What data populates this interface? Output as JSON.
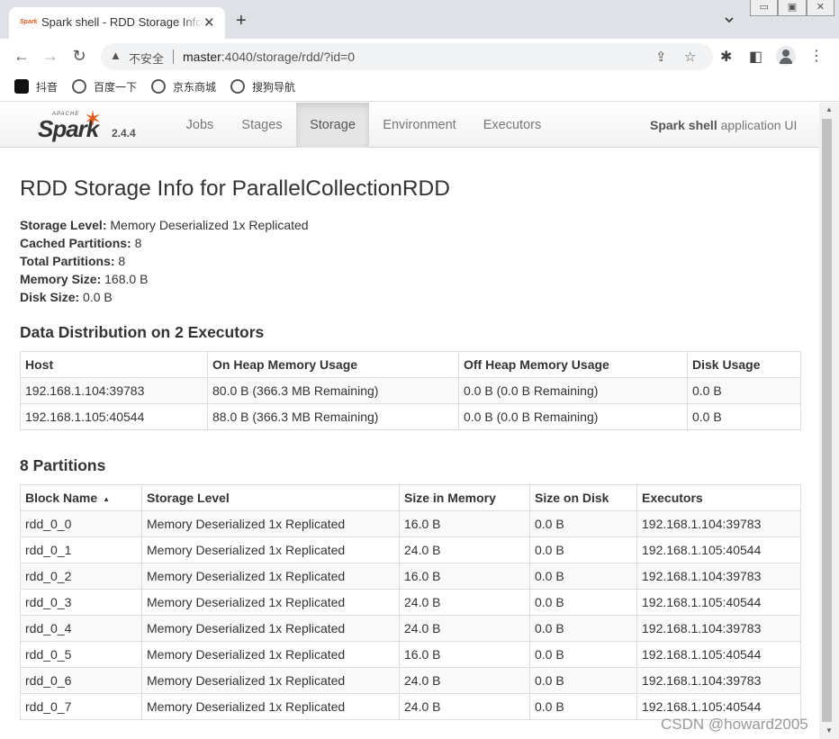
{
  "browser": {
    "tab_title": "Spark shell - RDD Storage Info for ParallelCollectionRDD",
    "favicon_text": "Spark",
    "new_tab_glyph": "+",
    "close_glyph": "✕",
    "security_label": "不安全",
    "url_host": "master",
    "url_rest": ":4040/storage/rdd/?id=0",
    "bookmarks": [
      {
        "label": "抖音",
        "color": "#111111"
      },
      {
        "label": "百度一下",
        "color": "#555555"
      },
      {
        "label": "京东商城",
        "color": "#555555"
      },
      {
        "label": "搜狗导航",
        "color": "#555555"
      }
    ]
  },
  "spark": {
    "version": "2.4.4",
    "nav": [
      "Jobs",
      "Stages",
      "Storage",
      "Environment",
      "Executors"
    ],
    "active_nav": "Storage",
    "app_name": "Spark shell",
    "app_suffix": " application UI",
    "logo_word": "Spark",
    "logo_small": "APACHE"
  },
  "page": {
    "title": "RDD Storage Info for ParallelCollectionRDD",
    "summary": [
      {
        "label": "Storage Level:",
        "value": " Memory Deserialized 1x Replicated"
      },
      {
        "label": "Cached Partitions:",
        "value": " 8"
      },
      {
        "label": "Total Partitions:",
        "value": " 8"
      },
      {
        "label": "Memory Size:",
        "value": " 168.0 B"
      },
      {
        "label": "Disk Size:",
        "value": " 0.0 B"
      }
    ],
    "distribution": {
      "heading": "Data Distribution on 2 Executors",
      "columns": [
        "Host",
        "On Heap Memory Usage",
        "Off Heap Memory Usage",
        "Disk Usage"
      ],
      "rows": [
        [
          "192.168.1.104:39783",
          "80.0 B (366.3 MB Remaining)",
          "0.0 B (0.0 B Remaining)",
          "0.0 B"
        ],
        [
          "192.168.1.105:40544",
          "88.0 B (366.3 MB Remaining)",
          "0.0 B (0.0 B Remaining)",
          "0.0 B"
        ]
      ]
    },
    "partitions": {
      "heading": "8 Partitions",
      "columns": [
        "Block Name",
        "Storage Level",
        "Size in Memory",
        "Size on Disk",
        "Executors"
      ],
      "sort_glyph": "▲",
      "rows": [
        [
          "rdd_0_0",
          "Memory Deserialized 1x Replicated",
          "16.0 B",
          "0.0 B",
          "192.168.1.104:39783"
        ],
        [
          "rdd_0_1",
          "Memory Deserialized 1x Replicated",
          "24.0 B",
          "0.0 B",
          "192.168.1.105:40544"
        ],
        [
          "rdd_0_2",
          "Memory Deserialized 1x Replicated",
          "16.0 B",
          "0.0 B",
          "192.168.1.104:39783"
        ],
        [
          "rdd_0_3",
          "Memory Deserialized 1x Replicated",
          "24.0 B",
          "0.0 B",
          "192.168.1.105:40544"
        ],
        [
          "rdd_0_4",
          "Memory Deserialized 1x Replicated",
          "24.0 B",
          "0.0 B",
          "192.168.1.104:39783"
        ],
        [
          "rdd_0_5",
          "Memory Deserialized 1x Replicated",
          "16.0 B",
          "0.0 B",
          "192.168.1.105:40544"
        ],
        [
          "rdd_0_6",
          "Memory Deserialized 1x Replicated",
          "24.0 B",
          "0.0 B",
          "192.168.1.104:39783"
        ],
        [
          "rdd_0_7",
          "Memory Deserialized 1x Replicated",
          "24.0 B",
          "0.0 B",
          "192.168.1.105:40544"
        ]
      ]
    }
  },
  "watermark": "CSDN @howard2005"
}
